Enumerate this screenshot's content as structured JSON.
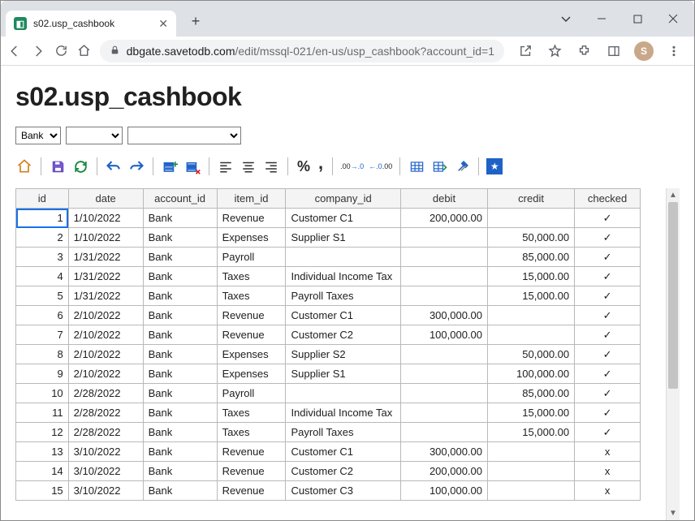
{
  "window": {
    "tab_title": "s02.usp_cashbook",
    "controls": {
      "chevron": "⌄",
      "min": "—",
      "max": "▢",
      "close": "✕"
    }
  },
  "addressbar": {
    "host": "dbgate.savetodb.com",
    "path": "/edit/mssql-021/en-us/usp_cashbook?account_id=1",
    "avatar_initial": "S"
  },
  "page": {
    "title": "s02.usp_cashbook"
  },
  "filters": {
    "f1": "Bank",
    "f2": "",
    "f3": ""
  },
  "toolbar": {
    "percent": "%",
    "comma": ",",
    "inc": ".00",
    "inc_arrow": "→.0",
    "dec": "←.0",
    "dec2": ".00"
  },
  "grid": {
    "headers": {
      "id": "id",
      "date": "date",
      "account_id": "account_id",
      "item_id": "item_id",
      "company_id": "company_id",
      "debit": "debit",
      "credit": "credit",
      "checked": "checked"
    },
    "rows": [
      {
        "id": "1",
        "date": "1/10/2022",
        "account": "Bank",
        "item": "Revenue",
        "company": "Customer C1",
        "debit": "200,000.00",
        "credit": "",
        "checked": "✓"
      },
      {
        "id": "2",
        "date": "1/10/2022",
        "account": "Bank",
        "item": "Expenses",
        "company": "Supplier S1",
        "debit": "",
        "credit": "50,000.00",
        "checked": "✓"
      },
      {
        "id": "3",
        "date": "1/31/2022",
        "account": "Bank",
        "item": "Payroll",
        "company": "",
        "debit": "",
        "credit": "85,000.00",
        "checked": "✓"
      },
      {
        "id": "4",
        "date": "1/31/2022",
        "account": "Bank",
        "item": "Taxes",
        "company": "Individual Income Tax",
        "debit": "",
        "credit": "15,000.00",
        "checked": "✓"
      },
      {
        "id": "5",
        "date": "1/31/2022",
        "account": "Bank",
        "item": "Taxes",
        "company": "Payroll Taxes",
        "debit": "",
        "credit": "15,000.00",
        "checked": "✓"
      },
      {
        "id": "6",
        "date": "2/10/2022",
        "account": "Bank",
        "item": "Revenue",
        "company": "Customer C1",
        "debit": "300,000.00",
        "credit": "",
        "checked": "✓"
      },
      {
        "id": "7",
        "date": "2/10/2022",
        "account": "Bank",
        "item": "Revenue",
        "company": "Customer C2",
        "debit": "100,000.00",
        "credit": "",
        "checked": "✓"
      },
      {
        "id": "8",
        "date": "2/10/2022",
        "account": "Bank",
        "item": "Expenses",
        "company": "Supplier S2",
        "debit": "",
        "credit": "50,000.00",
        "checked": "✓"
      },
      {
        "id": "9",
        "date": "2/10/2022",
        "account": "Bank",
        "item": "Expenses",
        "company": "Supplier S1",
        "debit": "",
        "credit": "100,000.00",
        "checked": "✓"
      },
      {
        "id": "10",
        "date": "2/28/2022",
        "account": "Bank",
        "item": "Payroll",
        "company": "",
        "debit": "",
        "credit": "85,000.00",
        "checked": "✓"
      },
      {
        "id": "11",
        "date": "2/28/2022",
        "account": "Bank",
        "item": "Taxes",
        "company": "Individual Income Tax",
        "debit": "",
        "credit": "15,000.00",
        "checked": "✓"
      },
      {
        "id": "12",
        "date": "2/28/2022",
        "account": "Bank",
        "item": "Taxes",
        "company": "Payroll Taxes",
        "debit": "",
        "credit": "15,000.00",
        "checked": "✓"
      },
      {
        "id": "13",
        "date": "3/10/2022",
        "account": "Bank",
        "item": "Revenue",
        "company": "Customer C1",
        "debit": "300,000.00",
        "credit": "",
        "checked": "x"
      },
      {
        "id": "14",
        "date": "3/10/2022",
        "account": "Bank",
        "item": "Revenue",
        "company": "Customer C2",
        "debit": "200,000.00",
        "credit": "",
        "checked": "x"
      },
      {
        "id": "15",
        "date": "3/10/2022",
        "account": "Bank",
        "item": "Revenue",
        "company": "Customer C3",
        "debit": "100,000.00",
        "credit": "",
        "checked": "x"
      }
    ]
  }
}
